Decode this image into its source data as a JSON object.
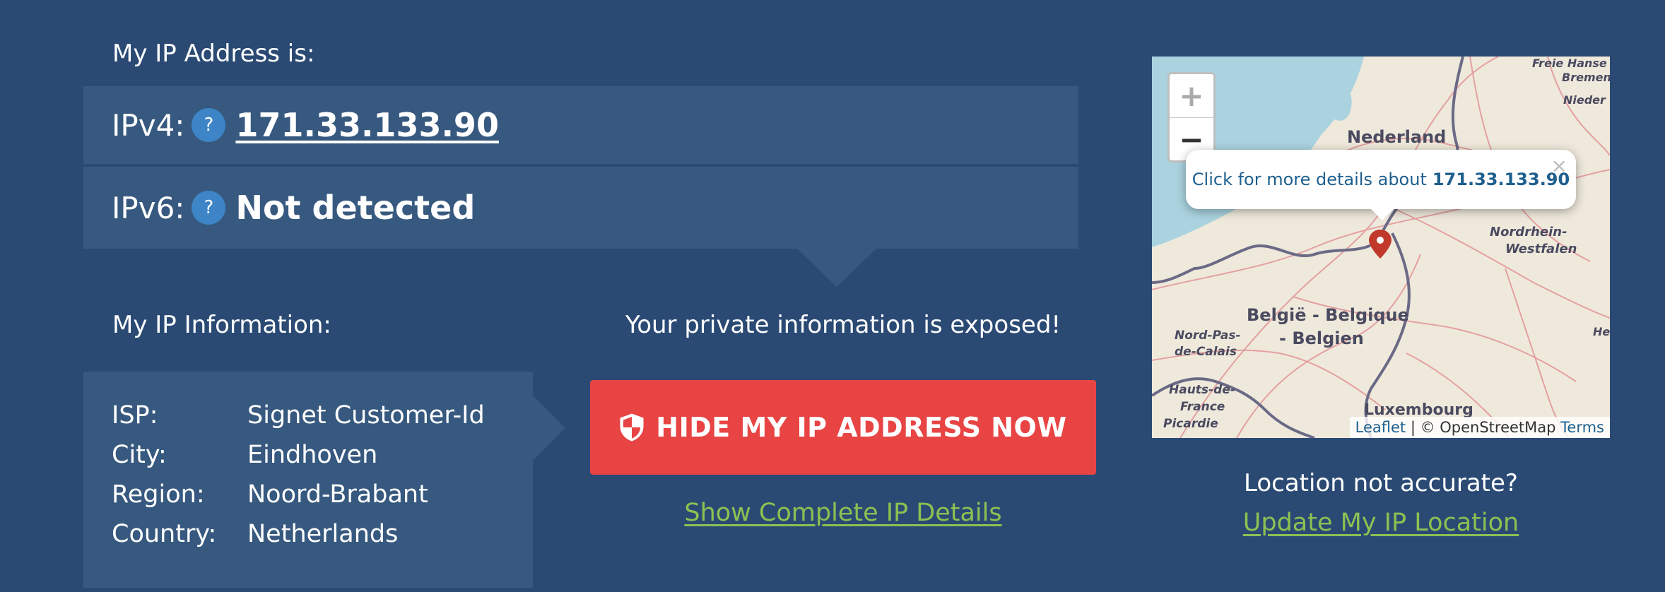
{
  "ip_section": {
    "heading": "My IP Address is:",
    "ipv4_label": "IPv4:",
    "ipv4_value": "171.33.133.90",
    "ipv6_label": "IPv6:",
    "ipv6_value": "Not detected",
    "help_glyph": "?"
  },
  "info_section": {
    "heading": "My IP Information:",
    "rows": [
      {
        "key": "ISP:",
        "value": "Signet Customer-Id"
      },
      {
        "key": "City:",
        "value": "Eindhoven"
      },
      {
        "key": "Region:",
        "value": "Noord-Brabant"
      },
      {
        "key": "Country:",
        "value": "Netherlands"
      }
    ]
  },
  "exposed": {
    "message": "Your private information is exposed!",
    "button_label": "HIDE MY IP ADDRESS NOW",
    "details_link": "Show Complete IP Details"
  },
  "map": {
    "zoom_in": "+",
    "zoom_out": "−",
    "popup_text": "Click for more details about",
    "popup_ip": "171.33.133.90",
    "popup_close": "×",
    "labels": {
      "nederland": "Nederland",
      "belgie": "België - Belgique",
      "belgien": "- Belgien",
      "nordrhein": "Nordrhein-",
      "westfalen": "Westfalen",
      "nordpas": "Nord-Pas-",
      "decalais": "de-Calais",
      "hauts": "Hauts-de-",
      "france": "France",
      "picardie": "Picardie",
      "luxembourg": "Luxembourg",
      "freie": "Freie Hanse",
      "bremen": "Bremen",
      "nieder": "Nieder",
      "he": "He"
    },
    "attribution_leaflet": "Leaflet",
    "attribution_sep": " | © OpenStreetMap ",
    "attribution_terms": "Terms"
  },
  "location": {
    "question": "Location not accurate?",
    "update_link": "Update My IP Location"
  },
  "colors": {
    "background": "#2a4a74",
    "panel": "#37597f",
    "button": "#e84444",
    "link": "#8cc152",
    "help_icon": "#3d85c6"
  },
  "icons": {
    "help": "question-icon",
    "shield": "shield-icon",
    "marker": "map-marker-icon"
  }
}
